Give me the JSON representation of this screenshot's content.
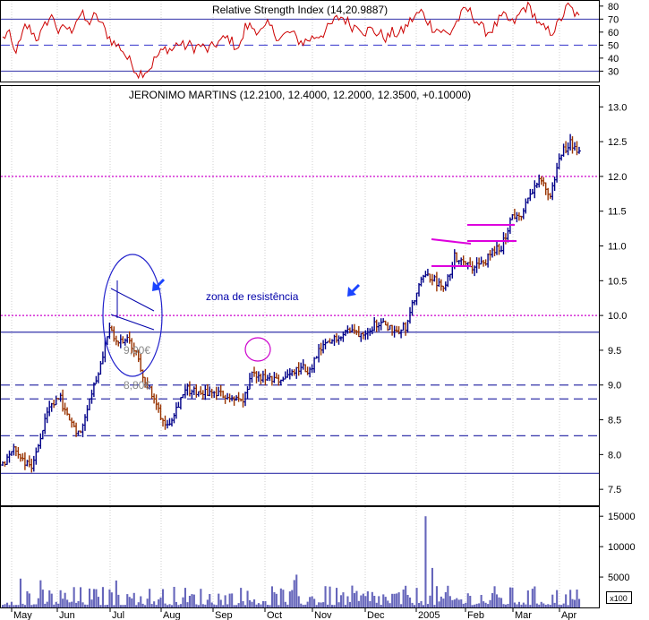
{
  "chart_data": {
    "type": "stock-chart",
    "title": "JERONIMO MARTINS (12.2100, 12.4000, 12.2000, 12.3500, +0.10000)",
    "rsi_panel": {
      "legend": "Relative Strength Index (14,20.9887)",
      "ticks": [
        30,
        40,
        50,
        60,
        70,
        80
      ],
      "ylim": [
        22,
        84
      ],
      "reference_lines": [
        {
          "value": 70,
          "style": "solid",
          "color": "#3333aa"
        },
        {
          "value": 50,
          "style": "dashed",
          "color": "#3333cc"
        },
        {
          "value": 30,
          "style": "solid",
          "color": "#3333aa"
        }
      ],
      "anchors": [
        55,
        60,
        45,
        50,
        65,
        62,
        55,
        60,
        70,
        72,
        58,
        65,
        60,
        70,
        74,
        66,
        72,
        70,
        62,
        55,
        50,
        48,
        40,
        35,
        28,
        30,
        32,
        40,
        44,
        48,
        46,
        52,
        49,
        50,
        48,
        50,
        46,
        48,
        52,
        54,
        56,
        50,
        48,
        65,
        64,
        62,
        60,
        66,
        60,
        55,
        58,
        60,
        55,
        52,
        54,
        56,
        58,
        60,
        65,
        70,
        72,
        68,
        64,
        66,
        60,
        62,
        60,
        58,
        55,
        60,
        58,
        62,
        68,
        72,
        76,
        70,
        64,
        62,
        60,
        58,
        66,
        72,
        78,
        74,
        68,
        62,
        60,
        64,
        70,
        72,
        66,
        70,
        78,
        80,
        74,
        64,
        62,
        60,
        64,
        72,
        80,
        76,
        70
      ],
      "color": "#cc0000"
    },
    "price_panel": {
      "ticks": [
        7.5,
        8.0,
        8.5,
        9.0,
        9.5,
        10.0,
        10.5,
        11.0,
        11.5,
        12.0,
        12.5,
        13.0
      ],
      "tick_labels": [
        "7.5",
        "8.0",
        "8.5",
        "9.0",
        "9.5",
        "10.0",
        "10.5",
        "11.0",
        "11.5",
        "12.0",
        "12.5",
        "13.0"
      ],
      "ylim": [
        7.27,
        13.3
      ],
      "last": {
        "open": 12.21,
        "high": 12.4,
        "low": 12.2,
        "close": 12.35,
        "change": 0.1
      },
      "close_anchors": [
        7.85,
        8.1,
        7.95,
        7.8,
        8.3,
        8.7,
        8.8,
        8.45,
        8.3,
        8.8,
        9.2,
        9.8,
        9.6,
        9.65,
        9.4,
        9.0,
        8.7,
        8.4,
        8.65,
        8.95,
        8.9,
        8.9,
        8.88,
        8.85,
        8.82,
        8.75,
        9.15,
        9.1,
        9.05,
        9.08,
        9.15,
        9.25,
        9.2,
        9.5,
        9.6,
        9.72,
        9.8,
        9.75,
        9.8,
        9.9,
        9.85,
        9.78,
        9.85,
        10.3,
        10.6,
        10.5,
        10.35,
        10.85,
        10.8,
        10.7,
        10.75,
        10.9,
        11.0,
        11.45,
        11.4,
        11.8,
        11.95,
        11.7,
        12.3,
        12.5,
        12.35
      ],
      "reference_lines": [
        {
          "value": 12.0,
          "style": "dotted",
          "color": "#cc00cc"
        },
        {
          "value": 10.0,
          "style": "dotted",
          "color": "#cc00cc"
        },
        {
          "value": 9.76,
          "style": "solid",
          "color": "#3333aa"
        },
        {
          "value": 9.0,
          "style": "dashed",
          "color": "#3333aa"
        },
        {
          "value": 8.8,
          "style": "dashed",
          "color": "#3333aa"
        },
        {
          "value": 8.27,
          "style": "dashed",
          "color": "#3333aa"
        },
        {
          "value": 7.73,
          "style": "solid",
          "color": "#3333aa"
        }
      ],
      "annotations": [
        {
          "text": "zona de resistência",
          "color": "#0000aa"
        },
        {
          "text": "9,00€",
          "color": "#888888"
        },
        {
          "text": "8,80€",
          "color": "#888888"
        }
      ]
    },
    "volume_panel": {
      "ticks": [
        5000,
        10000,
        15000
      ],
      "ylim": [
        0,
        16500
      ],
      "multiplier": "x100",
      "spike": 15000,
      "color": "#6666bb"
    },
    "x_axis": {
      "labels": [
        "May",
        "Jun",
        "Jul",
        "Aug",
        "Sep",
        "Oct",
        "Nov",
        "Dec",
        "2005",
        "Feb",
        "Mar",
        "Apr"
      ]
    },
    "grid": true
  }
}
